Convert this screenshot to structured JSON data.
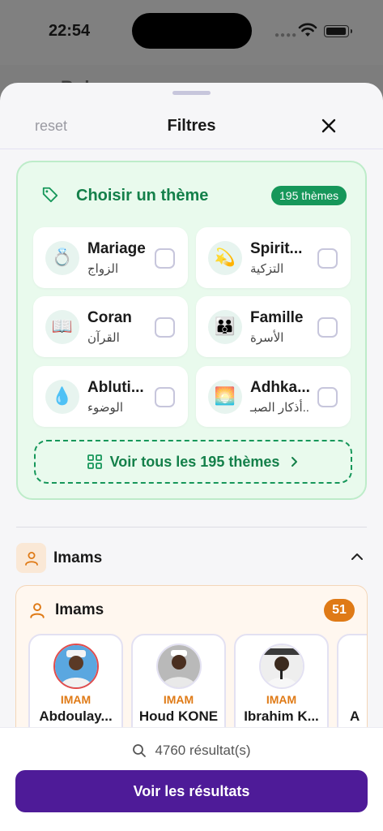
{
  "status_bar": {
    "time": "22:54",
    "signal_icon": "cellular-dots-icon",
    "wifi_icon": "wifi-icon",
    "battery_icon": "battery-icon"
  },
  "background_title": "Bul",
  "sheet": {
    "reset_label": "reset",
    "title": "Filtres",
    "close_icon": "close-icon"
  },
  "themes": {
    "heading": "Choisir un thème",
    "count_label": "195 thèmes",
    "items": [
      {
        "fr": "Mariage",
        "ar": "الزواج",
        "icon": "💍"
      },
      {
        "fr": "Spirit...",
        "ar": "التزكية",
        "icon": "💫"
      },
      {
        "fr": "Coran",
        "ar": "القرآن",
        "icon": "📖"
      },
      {
        "fr": "Famille",
        "ar": "الأسرة",
        "icon": "👪"
      },
      {
        "fr": "Abluti...",
        "ar": "الوضوء",
        "icon": "💧"
      },
      {
        "fr": "Adhka...",
        "ar": "أذكار الصبـ..",
        "icon": "🌅"
      }
    ],
    "see_all_label": "Voir tous les 195 thèmes"
  },
  "imams_section": {
    "title": "Imams",
    "card_title": "Imams",
    "count": "51",
    "items": [
      {
        "role": "IMAM",
        "name": "Abdoulay..."
      },
      {
        "role": "IMAM",
        "name": "Houd KONE"
      },
      {
        "role": "IMAM",
        "name": "Ibrahim K..."
      },
      {
        "role": "",
        "name": "A"
      }
    ]
  },
  "footer": {
    "results_text": "4760 résultat(s)",
    "button_label": "Voir les résultats"
  },
  "colors": {
    "accent_green": "#14804a",
    "accent_orange": "#df7a16",
    "primary_purple": "#4e1b98"
  }
}
